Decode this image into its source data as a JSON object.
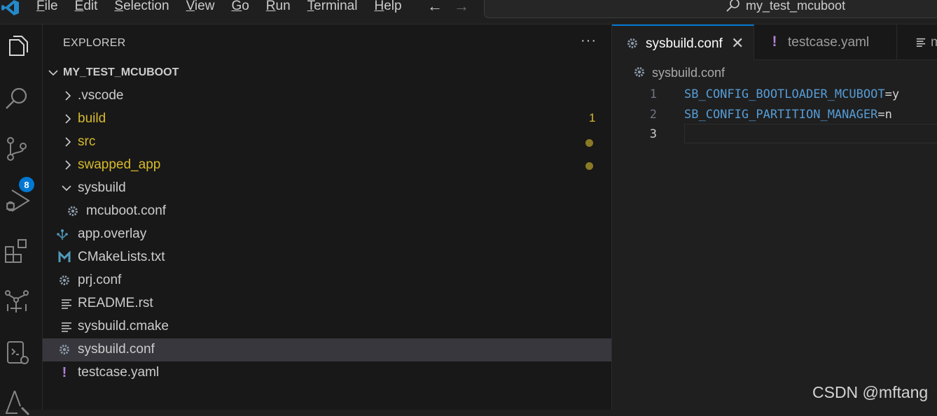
{
  "titlebar": {
    "menu": [
      {
        "label_u": "F",
        "label_rest": "ile"
      },
      {
        "label_u": "E",
        "label_rest": "dit"
      },
      {
        "label_u": "S",
        "label_rest": "election"
      },
      {
        "label_u": "V",
        "label_rest": "iew"
      },
      {
        "label_u": "G",
        "label_rest": "o"
      },
      {
        "label_u": "R",
        "label_rest": "un"
      },
      {
        "label_u": "T",
        "label_rest": "erminal"
      },
      {
        "label_u": "H",
        "label_rest": "elp"
      }
    ],
    "back_arrow": "←",
    "forward_arrow": "→",
    "search_text": "my_test_mcuboot"
  },
  "activitybar": {
    "icons": [
      "explorer-icon",
      "search-icon",
      "source-control-icon",
      "run-debug-icon",
      "extensions-icon",
      "device-tree-icon",
      "remote-explorer-icon",
      "testing-icon"
    ],
    "source_control_badge": "8"
  },
  "sidebar": {
    "title": "EXPLORER",
    "more": "···",
    "root": "MY_TEST_MCUBOOT",
    "items": [
      {
        "label": ".vscode",
        "kind": "folder",
        "expanded": false,
        "indent": 1,
        "modified": false
      },
      {
        "label": "build",
        "kind": "folder",
        "expanded": false,
        "indent": 1,
        "modified": true,
        "decoration": "1"
      },
      {
        "label": "src",
        "kind": "folder",
        "expanded": false,
        "indent": 1,
        "modified": true,
        "decoration": "dot"
      },
      {
        "label": "swapped_app",
        "kind": "folder",
        "expanded": false,
        "indent": 1,
        "modified": true,
        "decoration": "dot"
      },
      {
        "label": "sysbuild",
        "kind": "folder",
        "expanded": true,
        "indent": 1,
        "modified": false
      },
      {
        "label": "mcuboot.conf",
        "kind": "file",
        "icon": "gear-icon",
        "indent": 2
      },
      {
        "label": "app.overlay",
        "kind": "file",
        "icon": "device-tree-icon",
        "indent": 1
      },
      {
        "label": "CMakeLists.txt",
        "kind": "file",
        "icon": "cmake-m-icon",
        "indent": 1
      },
      {
        "label": "prj.conf",
        "kind": "file",
        "icon": "gear-icon",
        "indent": 1
      },
      {
        "label": "README.rst",
        "kind": "file",
        "icon": "lines-icon",
        "indent": 1
      },
      {
        "label": "sysbuild.cmake",
        "kind": "file",
        "icon": "lines-icon",
        "indent": 1
      },
      {
        "label": "sysbuild.conf",
        "kind": "file",
        "icon": "gear-icon",
        "indent": 1,
        "selected": true
      },
      {
        "label": "testcase.yaml",
        "kind": "file",
        "icon": "exclamation-icon",
        "indent": 1
      }
    ]
  },
  "editor": {
    "tabs": [
      {
        "label": "sysbuild.conf",
        "icon": "gear-icon",
        "active": true,
        "close": "✕"
      },
      {
        "label": "testcase.yaml",
        "icon": "exclamation-icon",
        "active": false
      },
      {
        "label": "m",
        "icon": "lines-icon",
        "active": false
      }
    ],
    "breadcrumb": "sysbuild.conf",
    "lines": [
      {
        "num": "1",
        "key": "SB_CONFIG_BOOTLOADER_MCUBOOT",
        "op": "=",
        "val": "y"
      },
      {
        "num": "2",
        "key": "SB_CONFIG_PARTITION_MANAGER",
        "op": "=",
        "val": "n"
      },
      {
        "num": "3",
        "key": "",
        "op": "",
        "val": ""
      }
    ]
  },
  "watermark": "CSDN @mftang",
  "colors": {
    "accent": "#0078d4",
    "modified": "#d7ba2d",
    "keyword": "#569cd6",
    "yaml": "#b180d7"
  }
}
